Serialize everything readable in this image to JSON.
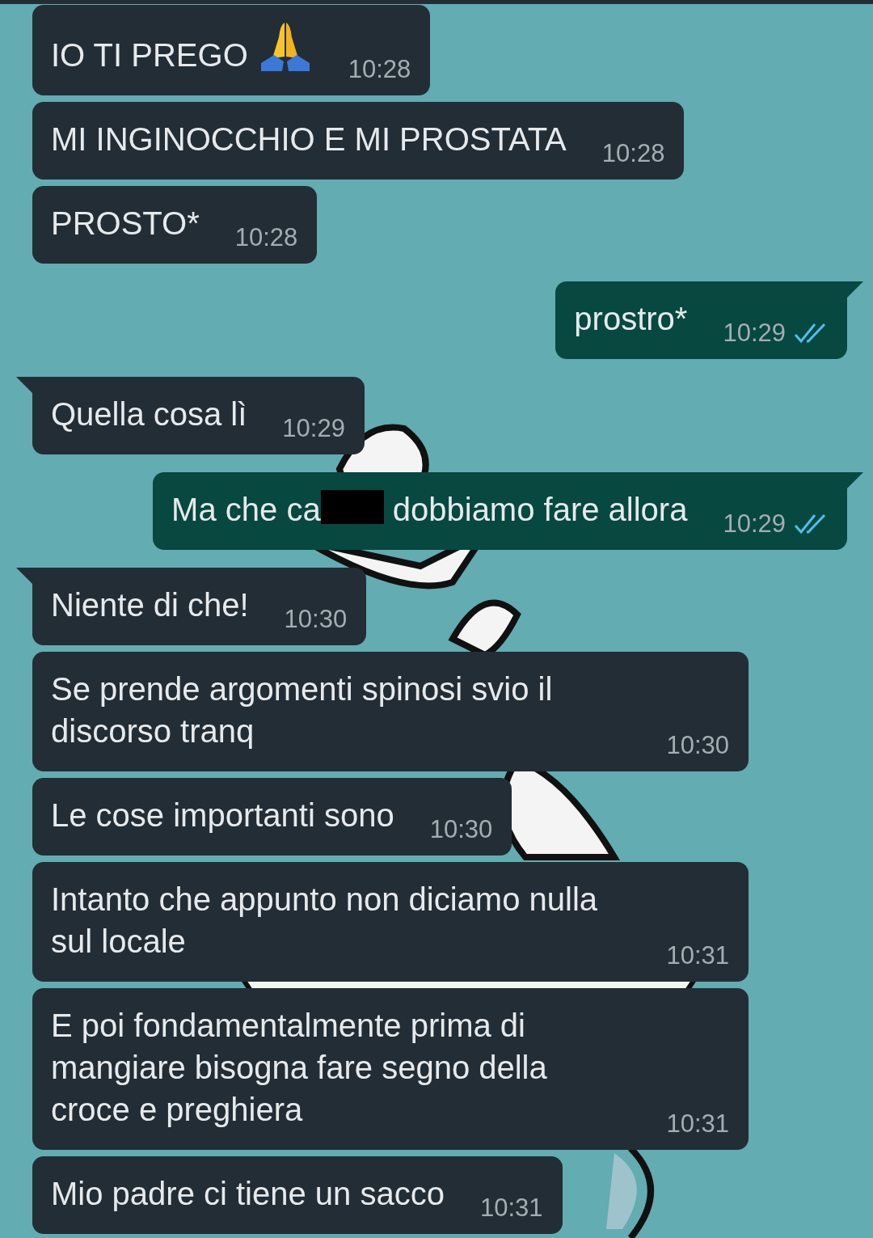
{
  "messages": [
    {
      "kind": "incoming",
      "tail": false,
      "text": "IO TI PREGO",
      "emoji": true,
      "time": "10:28"
    },
    {
      "kind": "incoming",
      "tail": false,
      "text": "MI INGINOCCHIO E MI PROSTATA",
      "time": "10:28"
    },
    {
      "kind": "incoming",
      "tail": false,
      "text": "PROSTO*",
      "time": "10:28"
    },
    {
      "kind": "outgoing",
      "tail": true,
      "text": "prostro*",
      "time": "10:29",
      "read": true
    },
    {
      "kind": "incoming",
      "tail": true,
      "text": "Quella cosa lì",
      "time": "10:29"
    },
    {
      "kind": "outgoing",
      "tail": true,
      "text": "Ma che ca",
      "redacted": true,
      "text_after": "dobbiamo fare allora",
      "time": "10:29",
      "read": true
    },
    {
      "kind": "incoming",
      "tail": true,
      "text": "Niente di che!",
      "time": "10:30"
    },
    {
      "kind": "incoming",
      "tail": false,
      "text": "Se prende argomenti spinosi svio il discorso tranq",
      "time": "10:30"
    },
    {
      "kind": "incoming",
      "tail": false,
      "text": "Le cose importanti sono",
      "time": "10:30"
    },
    {
      "kind": "incoming",
      "tail": false,
      "text": "Intanto che appunto non diciamo nulla sul locale",
      "time": "10:31"
    },
    {
      "kind": "incoming",
      "tail": false,
      "text": "E poi fondamentalmente prima di mangiare bisogna fare segno della croce e preghiera",
      "time": "10:31"
    },
    {
      "kind": "incoming",
      "tail": false,
      "text": "Mio padre ci tiene un sacco",
      "time": "10:31"
    }
  ]
}
